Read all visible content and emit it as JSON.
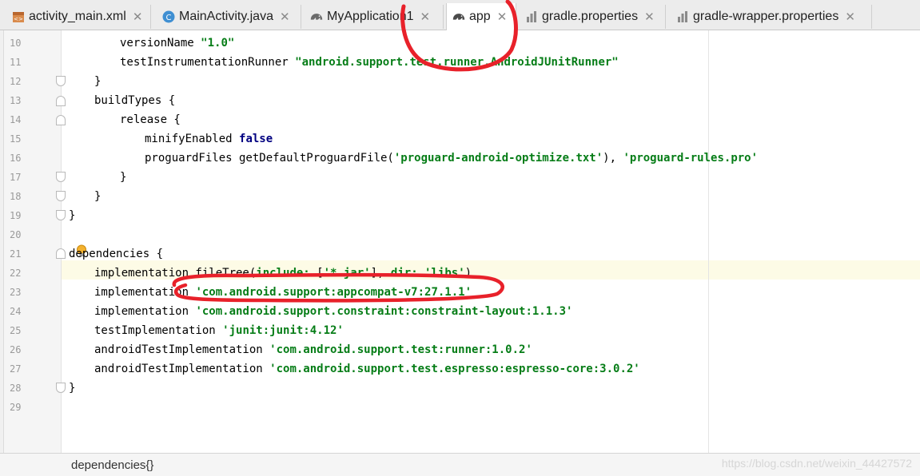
{
  "tabs": [
    {
      "label": "activity_main.xml",
      "icon": "xml-file-icon",
      "close": "✕"
    },
    {
      "label": "MainActivity.java",
      "icon": "java-class-icon",
      "close": "✕"
    },
    {
      "label": "MyApplication1",
      "icon": "gradle-elephant-icon",
      "close": "✕"
    },
    {
      "label": "app",
      "icon": "gradle-elephant-icon",
      "close": "✕"
    },
    {
      "label": "gradle.properties",
      "icon": "properties-file-icon",
      "close": "✕"
    },
    {
      "label": "gradle-wrapper.properties",
      "icon": "properties-file-icon",
      "close": "✕"
    }
  ],
  "active_tab": "app",
  "lines": [
    {
      "n": "10",
      "parts": [
        [
          "nm",
          "versionName "
        ],
        [
          "str",
          "\"1.0\""
        ]
      ]
    },
    {
      "n": "11",
      "parts": [
        [
          "nm",
          "testInstrumentationRunner "
        ],
        [
          "str",
          "\"android.support.test.runner.AndroidJUnitRunner\""
        ]
      ]
    },
    {
      "n": "12",
      "parts": [
        [
          "nm",
          "}"
        ]
      ]
    },
    {
      "n": "13",
      "parts": [
        [
          "nm",
          "buildTypes {"
        ]
      ]
    },
    {
      "n": "14",
      "parts": [
        [
          "nm",
          "release {"
        ]
      ]
    },
    {
      "n": "15",
      "parts": [
        [
          "nm",
          "minifyEnabled "
        ],
        [
          "kw",
          "false"
        ]
      ]
    },
    {
      "n": "16",
      "parts": [
        [
          "nm",
          "proguardFiles getDefaultProguardFile("
        ],
        [
          "str",
          "'proguard-android-optimize.txt'"
        ],
        [
          "nm",
          "), "
        ],
        [
          "str",
          "'proguard-rules.pro'"
        ]
      ]
    },
    {
      "n": "17",
      "parts": [
        [
          "nm",
          "}"
        ]
      ]
    },
    {
      "n": "18",
      "parts": [
        [
          "nm",
          "}"
        ]
      ]
    },
    {
      "n": "19",
      "parts": [
        [
          "nm",
          "}"
        ]
      ]
    },
    {
      "n": "20",
      "parts": []
    },
    {
      "n": "21",
      "parts": [
        [
          "nm",
          "dependencies {"
        ]
      ]
    },
    {
      "n": "22",
      "parts": [
        [
          "nm",
          "implementation fileTree("
        ],
        [
          "str",
          "include: "
        ],
        [
          "nm",
          "["
        ],
        [
          "str",
          "'*.jar'"
        ],
        [
          "nm",
          "], "
        ],
        [
          "str",
          "dir: 'libs'"
        ],
        [
          "nm",
          ")"
        ]
      ]
    },
    {
      "n": "23",
      "parts": [
        [
          "nm",
          "implementation "
        ],
        [
          "str",
          "'com.android.support:appcompat-v7:27.1.1'"
        ]
      ]
    },
    {
      "n": "24",
      "parts": [
        [
          "nm",
          "implementation "
        ],
        [
          "str",
          "'com.android.support.constraint:constraint-layout:1.1.3'"
        ]
      ]
    },
    {
      "n": "25",
      "parts": [
        [
          "nm",
          "testImplementation "
        ],
        [
          "str",
          "'junit:junit:4.12'"
        ]
      ]
    },
    {
      "n": "26",
      "parts": [
        [
          "nm",
          "androidTestImplementation "
        ],
        [
          "str",
          "'com.android.support.test:runner:1.0.2'"
        ]
      ]
    },
    {
      "n": "27",
      "parts": [
        [
          "nm",
          "androidTestImplementation "
        ],
        [
          "str",
          "'com.android.support.test.espresso:espresso-core:3.0.2'"
        ]
      ]
    },
    {
      "n": "28",
      "parts": [
        [
          "nm",
          "}"
        ]
      ]
    },
    {
      "n": "29",
      "parts": []
    }
  ],
  "breadcrumb": "dependencies{}",
  "watermark": "https://blog.csdn.net/weixin_44427572",
  "colors": {
    "string": "#067d17",
    "keyword": "#000080",
    "annotation": "#e8212a",
    "current_line": "#fdfbe6"
  }
}
